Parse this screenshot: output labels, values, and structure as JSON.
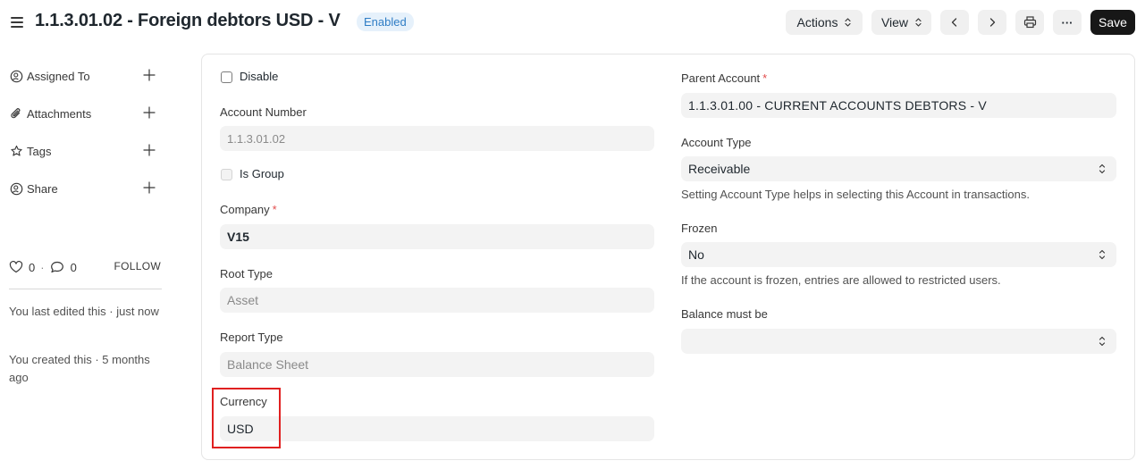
{
  "header": {
    "title": "1.1.3.01.02 - Foreign debtors USD - V",
    "status": "Enabled",
    "actions_label": "Actions",
    "view_label": "View",
    "save_label": "Save",
    "more_label": "···"
  },
  "sidebar": {
    "items": [
      {
        "label": "Assigned To",
        "icon": "assign-user-icon"
      },
      {
        "label": "Attachments",
        "icon": "paperclip-icon"
      },
      {
        "label": "Tags",
        "icon": "tag-icon"
      },
      {
        "label": "Share",
        "icon": "share-user-icon"
      }
    ],
    "likes": "0",
    "comments": "0",
    "separator": "·",
    "follow_label": "FOLLOW",
    "last_edited": "You last edited this · just now",
    "created": "You created this · 5 months ago"
  },
  "form": {
    "disable_label": "Disable",
    "account_number": {
      "label": "Account Number",
      "value": "1.1.3.01.02"
    },
    "is_group_label": "Is Group",
    "company": {
      "label": "Company",
      "value": "V15",
      "required": "*"
    },
    "root_type": {
      "label": "Root Type",
      "value": "Asset"
    },
    "report_type": {
      "label": "Report Type",
      "value": "Balance Sheet"
    },
    "currency": {
      "label": "Currency",
      "value": "USD"
    },
    "parent_account": {
      "label": "Parent Account",
      "value": "1.1.3.01.00 - CURRENT ACCOUNTS DEBTORS - V",
      "required": "*"
    },
    "account_type": {
      "label": "Account Type",
      "value": "Receivable",
      "help": "Setting Account Type helps in selecting this Account in transactions."
    },
    "frozen": {
      "label": "Frozen",
      "value": "No",
      "help": "If the account is frozen, entries are allowed to restricted users."
    },
    "balance_must_be": {
      "label": "Balance must be",
      "value": ""
    }
  },
  "colors": {
    "accent": "#171717",
    "badge_text": "#2f7dc5",
    "badge_bg": "#e6f1fb",
    "required": "#e24c4c",
    "highlight": "#e02020"
  }
}
